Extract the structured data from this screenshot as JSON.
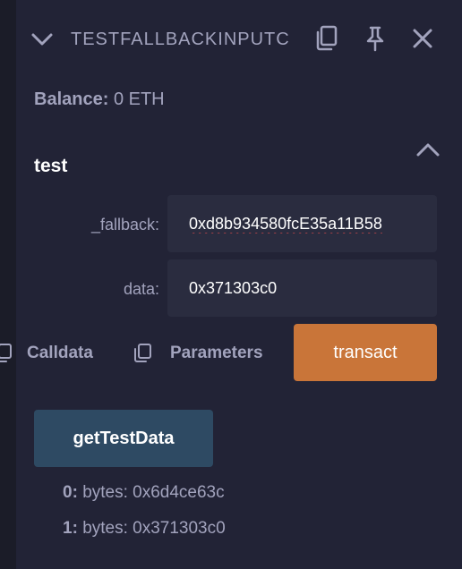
{
  "contract": {
    "title": "TESTFALLBACKINPUTC",
    "balance_label": "Balance:",
    "balance_value": "0 ETH"
  },
  "icons": {
    "header": [
      "chevron-down-icon",
      "copy-icon",
      "pin-icon",
      "close-icon"
    ],
    "collapse": "chevron-up-icon"
  },
  "function": {
    "name": "test",
    "inputs": [
      {
        "label": "_fallback:",
        "value": "0xd8b934580fcE35a11B58"
      },
      {
        "label": "data:",
        "value": "0x371303c0"
      }
    ],
    "calldata_label": "Calldata",
    "parameters_label": "Parameters",
    "transact_label": "transact"
  },
  "call": {
    "button_label": "getTestData",
    "outputs": [
      {
        "index": "0:",
        "text": "bytes: 0x6d4ce63c"
      },
      {
        "index": "1:",
        "text": "bytes: 0x371303c0"
      }
    ]
  },
  "colors": {
    "background": "#222336",
    "transact": "#c97539",
    "call_button": "#2e4a63",
    "text": "#a2a3bd"
  }
}
